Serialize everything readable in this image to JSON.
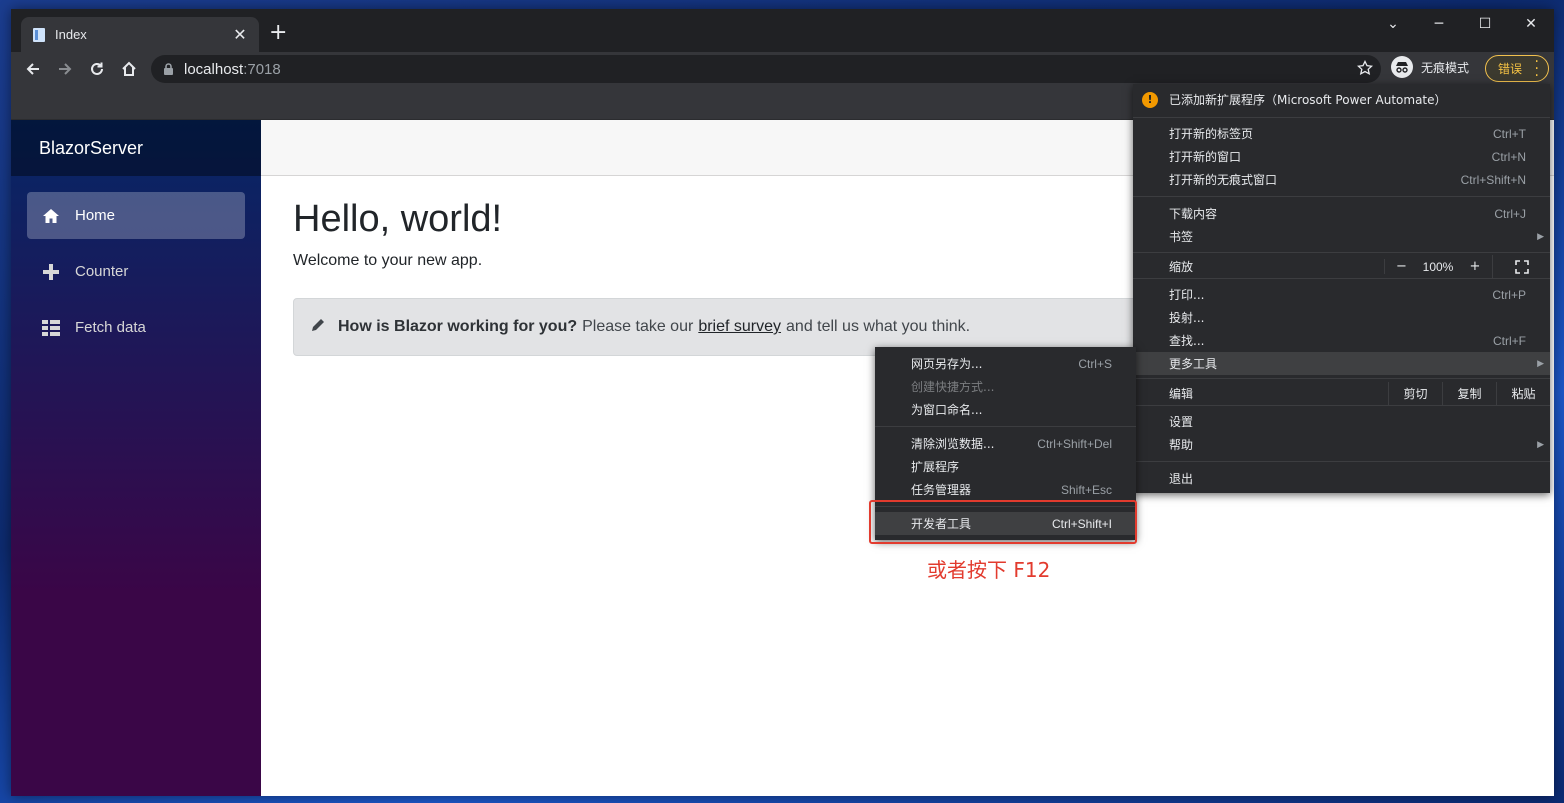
{
  "browser": {
    "tab_title": "Index",
    "new_tab": "+",
    "url_host": "localhost",
    "url_port": ":7018",
    "incognito_label": "无痕模式",
    "error_button_label": "错误"
  },
  "window_controls": {
    "minimize": "─",
    "maximize": "☐",
    "close": "✕",
    "tab_search": "⌄"
  },
  "app": {
    "brand": "BlazorServer",
    "nav": [
      {
        "label": "Home",
        "icon": "home-icon"
      },
      {
        "label": "Counter",
        "icon": "plus-icon"
      },
      {
        "label": "Fetch data",
        "icon": "list-icon"
      }
    ],
    "heading": "Hello, world!",
    "welcome": "Welcome to your new app.",
    "survey": {
      "question": "How is Blazor working for you?",
      "text_before": "Please take our",
      "link": "brief survey",
      "text_after": "and tell us what you think."
    }
  },
  "main_menu": {
    "extension_notice": "已添加新扩展程序（Microsoft Power Automate）",
    "new_tab": {
      "label": "打开新的标签页",
      "shortcut": "Ctrl+T"
    },
    "new_window": {
      "label": "打开新的窗口",
      "shortcut": "Ctrl+N"
    },
    "new_incognito": {
      "label": "打开新的无痕式窗口",
      "shortcut": "Ctrl+Shift+N"
    },
    "downloads": {
      "label": "下载内容",
      "shortcut": "Ctrl+J"
    },
    "bookmarks": {
      "label": "书签"
    },
    "zoom": {
      "label": "缩放",
      "minus": "−",
      "value": "100%",
      "plus": "+"
    },
    "print": {
      "label": "打印...",
      "shortcut": "Ctrl+P"
    },
    "cast": {
      "label": "投射..."
    },
    "find": {
      "label": "查找...",
      "shortcut": "Ctrl+F"
    },
    "more_tools": {
      "label": "更多工具"
    },
    "edit": {
      "label": "编辑",
      "cut": "剪切",
      "copy": "复制",
      "paste": "粘贴"
    },
    "settings": {
      "label": "设置"
    },
    "help": {
      "label": "帮助"
    },
    "exit": {
      "label": "退出"
    }
  },
  "more_tools_menu": {
    "save_page": {
      "label": "网页另存为...",
      "shortcut": "Ctrl+S"
    },
    "create_shortcut": {
      "label": "创建快捷方式..."
    },
    "name_window": {
      "label": "为窗口命名..."
    },
    "clear_data": {
      "label": "清除浏览数据...",
      "shortcut": "Ctrl+Shift+Del"
    },
    "extensions": {
      "label": "扩展程序"
    },
    "task_manager": {
      "label": "任务管理器",
      "shortcut": "Shift+Esc"
    },
    "dev_tools": {
      "label": "开发者工具",
      "shortcut": "Ctrl+Shift+I"
    }
  },
  "annotation": {
    "text": "或者按下 F12",
    "color": "#e23b2e"
  },
  "colors": {
    "sidebar_top": "#052767",
    "sidebar_bottom": "#3a0647",
    "menu_bg": "#292a2d",
    "accent_warning": "#f29900"
  }
}
